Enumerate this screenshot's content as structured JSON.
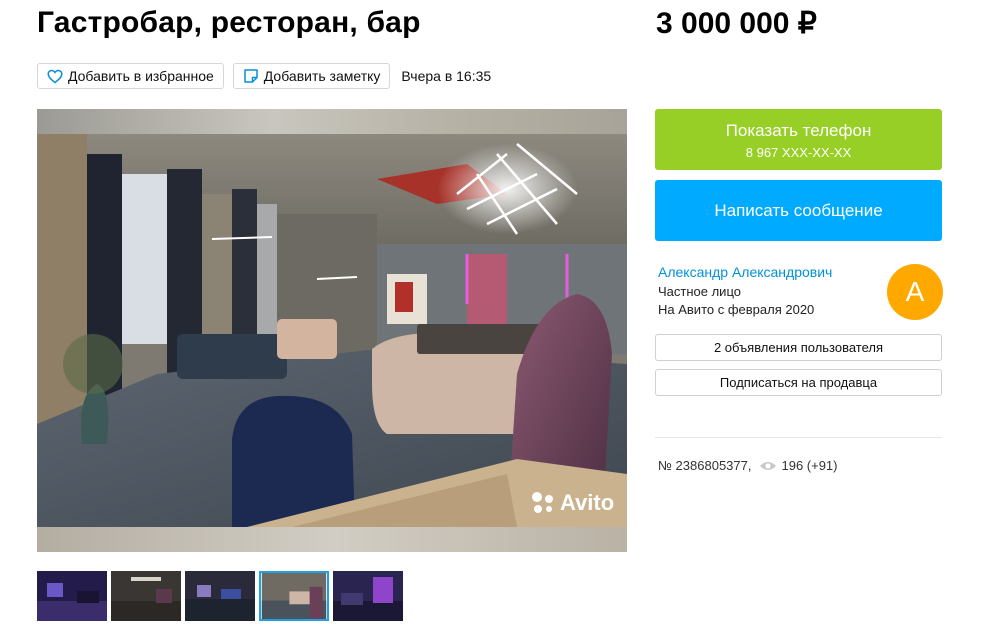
{
  "listing": {
    "title": "Гастробар, ресторан, бар",
    "price": "3 000 000 ₽",
    "date": "Вчера в 16:35"
  },
  "actions": {
    "favorite_label": "Добавить в избранное",
    "note_label": "Добавить заметку"
  },
  "gallery": {
    "watermark": "Avito",
    "thumbnail_count": 5,
    "active_thumbnail": 4
  },
  "contact": {
    "show_phone_label": "Показать телефон",
    "phone_masked": "8 967 XXX-XX-XX",
    "message_label": "Написать сообщение"
  },
  "seller": {
    "name": "Александр Александрович",
    "type": "Частное лицо",
    "since": "На Авито с февраля 2020",
    "avatar_letter": "A",
    "listings_label": "2 объявления пользователя",
    "subscribe_label": "Подписаться на продавца"
  },
  "meta": {
    "ad_number": "№ 2386805377,",
    "views": "196 (+91)"
  },
  "colors": {
    "phone_button": "#97cf26",
    "message_button": "#00aaff",
    "seller_link": "#0091d9",
    "avatar": "#ffa800",
    "active_thumb_border": "#21a1de"
  },
  "icons": {
    "favorite": "heart-icon",
    "note": "note-icon",
    "views": "eye-icon",
    "watermark": "avito-logo-icon"
  }
}
